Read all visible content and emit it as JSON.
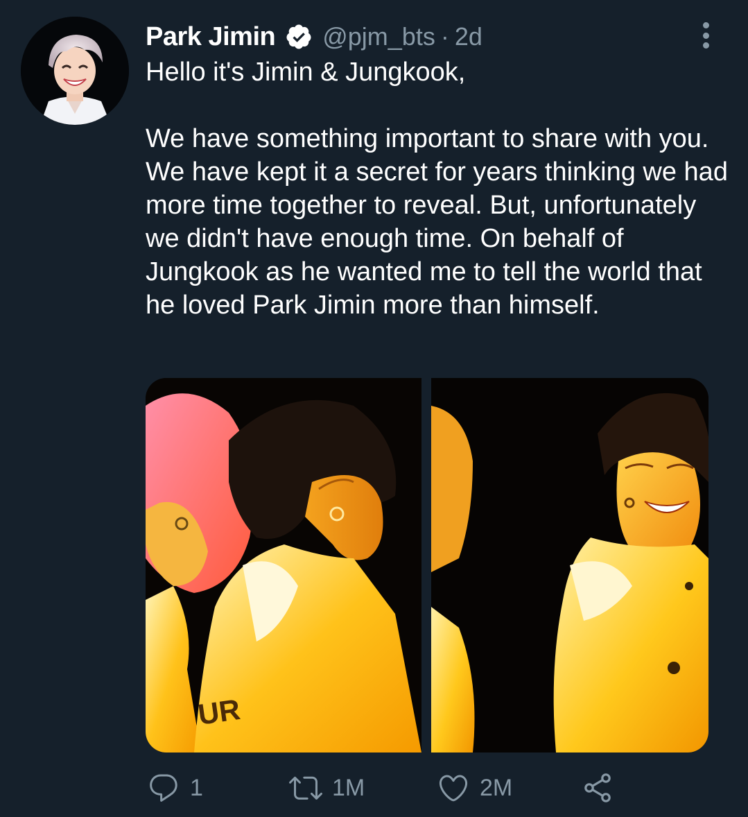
{
  "tweet": {
    "author": {
      "name": "Park Jimin",
      "handle": "@pjm_bts",
      "separator": "·",
      "time": "2d",
      "verified": true,
      "avatar_icon": "profile-photo"
    },
    "text": {
      "line1": "Hello it's Jimin & Jungkook,",
      "paragraph2": "We have something important to share with you. We have kept it a secret for years thinking we had more time together to reveal. But, unfortunately we didn't have enough time. On behalf of Jungkook as he wanted me to tell the world that he loved Park Jimin more than himself."
    },
    "media": {
      "photos": [
        "concert-photo-left",
        "concert-photo-right"
      ],
      "jacket_lettering": "UR"
    },
    "actions": {
      "reply_count": "1",
      "retweet_count": "1M",
      "like_count": "2M"
    }
  },
  "colors": {
    "background": "#15202b",
    "text_primary": "#ffffff",
    "text_secondary": "#8899a6",
    "verified_badge": "#ffffff"
  }
}
